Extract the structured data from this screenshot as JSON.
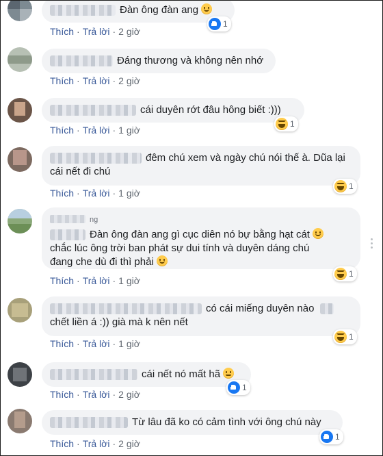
{
  "actions": {
    "like": "Thích",
    "reply": "Trả lời",
    "separator": "·"
  },
  "comments": [
    {
      "text": "Đàn ông đàn ang",
      "emoji": "slightly-smiling-face-icon",
      "time": "2 giờ",
      "reaction": {
        "type": "like-icon",
        "count": "1"
      }
    },
    {
      "text": "Đáng thương và không nên nhớ",
      "time": "2 giờ"
    },
    {
      "text": "cái duyên rớt đâu hông biết :)))",
      "time": "1 giờ",
      "reaction": {
        "type": "haha-icon",
        "count": "1"
      }
    },
    {
      "text": "đêm chú xem và ngày chú nói thế à. Dũa lại cái nết đi chú",
      "time": "1 giờ",
      "reaction": {
        "type": "haha-icon",
        "count": "1"
      }
    },
    {
      "name_suffix": "ng",
      "text": "Đàn ông đàn ang gì cục diên nó bự bằng hạt cát",
      "text2": "chắc lúc ông trời ban phát sự dui tính và duyên dáng chú",
      "text3": "đang che dù đi thì phải",
      "time": "1 giờ",
      "reaction": {
        "type": "haha-icon",
        "count": "1"
      }
    },
    {
      "text": "có cái miếng duyên nào",
      "text2": "chết liền á :)) già mà k nên nết",
      "time": "1 giờ",
      "reaction": {
        "type": "haha-icon",
        "count": "1"
      }
    },
    {
      "text": "cái nết nó mất hã",
      "emoji": "neutral-face-icon",
      "time": "2 giờ",
      "reaction": {
        "type": "like-icon",
        "count": "1"
      }
    },
    {
      "text": "Từ lâu đã ko có cảm tình với ông chú này",
      "time": "2 giờ",
      "reaction": {
        "type": "like-icon",
        "count": "1"
      }
    }
  ]
}
